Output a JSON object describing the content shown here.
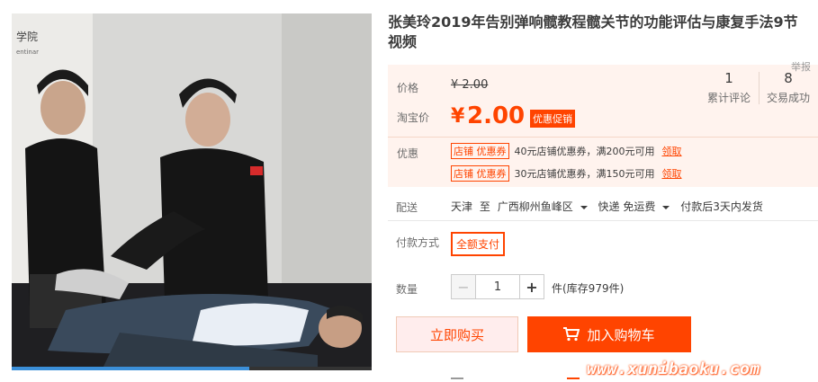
{
  "product": {
    "title": "张美玲2019年告别弹响髋教程髋关节的功能评估与康复手法9节视频",
    "corner_mark": "举报"
  },
  "media": {
    "sign_text": "学院",
    "sign_sub": "entinar",
    "progress": 0.66
  },
  "price": {
    "label": "价格",
    "original": "¥ 2.00",
    "taobao_label": "淘宝价",
    "currency": "¥",
    "current": "2.00",
    "promo_badge": "优惠促销"
  },
  "stats": [
    {
      "num": "1",
      "caption": "累计评论"
    },
    {
      "num": "8",
      "caption": "交易成功"
    }
  ],
  "coupons": {
    "label": "优惠",
    "items": [
      {
        "tag": "店铺 优惠券",
        "text": "40元店铺优惠券，满200元可用",
        "action": "领取"
      },
      {
        "tag": "店铺 优惠券",
        "text": "30元店铺优惠券，满150元可用",
        "action": "领取"
      }
    ]
  },
  "shipping": {
    "label": "配送",
    "from": "天津",
    "to_word": "至",
    "destination": "广西柳州鱼峰区",
    "method": "快递 免运费",
    "dispatch": "付款后3天内发货"
  },
  "payment": {
    "label": "付款方式",
    "option": "全额支付"
  },
  "quantity": {
    "label": "数量",
    "minus": "−",
    "value": "1",
    "plus": "+",
    "stock_text": "件(库存979件)"
  },
  "actions": {
    "buy_now": "立即购买",
    "add_cart": "加入购物车"
  },
  "watermark": "www.xunibaoku.com",
  "colors": {
    "accent": "#ff4400",
    "price_bg": "#fff3ee"
  }
}
